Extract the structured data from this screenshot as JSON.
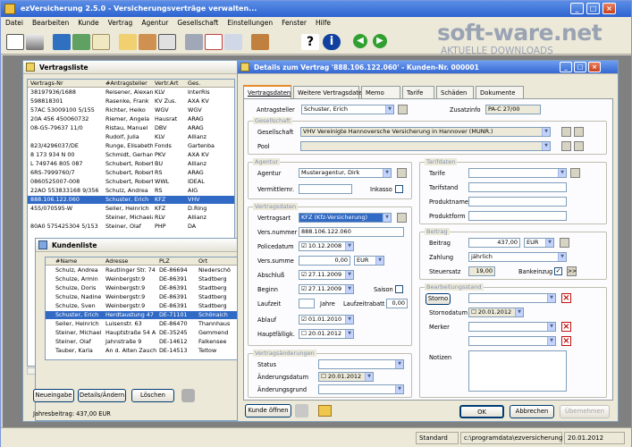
{
  "app": {
    "title": "ezVersicherung 2.5.0  -  Versicherungsverträge verwalten...",
    "watermark_top": "soft-ware.net",
    "watermark_bottom": "AKTUELLE DOWNLOADS"
  },
  "menu": [
    "Datei",
    "Bearbeiten",
    "Kunde",
    "Vertrag",
    "Agentur",
    "Gesellschaft",
    "Einstellungen",
    "Fenster",
    "Hilfe"
  ],
  "vertragsliste": {
    "title": "Vertragsliste",
    "headers": [
      "Vertrags-Nr",
      "#Antragsteller",
      "Vertr.Art",
      "Ges."
    ],
    "rows": [
      [
        "38197936/1688",
        "Reisener, Alexander",
        "KLV",
        "InterRis"
      ],
      [
        "598818301",
        "Rasenke, Frank",
        "KV Zus.",
        "AXA KV"
      ],
      [
        "57AC 53009100 5/155",
        "Richter, Heiko",
        "WGV",
        "WGV"
      ],
      [
        "20A 456 450060732",
        "Riemer, Angela",
        "Hausrat",
        "ARAG"
      ],
      [
        "08-G5-79637 11/0",
        "Ristau, Manuel",
        "DBV",
        "ARAG"
      ],
      [
        "",
        "Rudolf, Julia",
        "KLV",
        "Allianz"
      ],
      [
        "823/4296037/DE",
        "Runge, Elisabeth",
        "Fonds",
        "Gartenba"
      ],
      [
        "8 173 934 N 00",
        "Schmidt, Gerhardt",
        "PKV",
        "AXA KV"
      ],
      [
        "L 749746 805 087",
        "Schubert, Robert",
        "BU",
        "Allianz"
      ],
      [
        "6RS-7999760/7",
        "Schubert, Robert",
        "RS",
        "ARAG"
      ],
      [
        "0860525007-008",
        "Schubert, Robert",
        "WWL",
        "IDEAL"
      ],
      [
        "22AO 553833168 9/356",
        "Schulz, Andrea",
        "RS",
        "AIG"
      ],
      [
        "888.106.122.060",
        "Schuster, Erich",
        "KFZ",
        "VHV"
      ],
      [
        "455/070595-W",
        "Seiler, Heinrich",
        "KFZ",
        "D.Ring"
      ],
      [
        "",
        "Steiner, Michaela",
        "RLV",
        "Allianz"
      ],
      [
        "80A0 575425304 5/153",
        "Steiner, Olaf",
        "PHP",
        "DA"
      ]
    ],
    "selected_row": 12
  },
  "kundenliste": {
    "title": "Kundenliste",
    "headers": [
      "#Name",
      "Adresse",
      "PLZ",
      "Ort"
    ],
    "rows": [
      [
        "Schulz, Andrea",
        "Rautlinger Str. 74",
        "DE-86694",
        "Niederschö"
      ],
      [
        "Schulze, Armin",
        "Weinbergstr.9",
        "DE-86391",
        "Stadtberg"
      ],
      [
        "Schulze, Doris",
        "Weinbergstr.9",
        "DE-86391",
        "Stadtberg"
      ],
      [
        "Schulze, Nadine",
        "Weinbergstr.9",
        "DE-86391",
        "Stadtberg"
      ],
      [
        "Schulze, Sven",
        "Weinbergstr.9",
        "DE-86391",
        "Stadtberg"
      ],
      [
        "Schuster, Erich",
        "Herdtaustung 47",
        "DE-71101",
        "Schönaich"
      ],
      [
        "Seiler, Heinrich",
        "Luisenstr. 63",
        "DE-86470",
        "Thannhaus"
      ],
      [
        "Steiner, Michaela",
        "Hauptstraße 54 A",
        "DE-35245",
        "Gemmend"
      ],
      [
        "Steiner, Olaf",
        "Jahnstraße 9",
        "DE-14612",
        "Falkensee"
      ],
      [
        "Tauber, Karla",
        "An d. Alten Zauche 2",
        "DE-14513",
        "Teltow"
      ]
    ],
    "selected_row": 5,
    "buttons": {
      "new": "Neueingabe",
      "edit": "Details/Ändern",
      "delete": "Löschen"
    },
    "footer": "Jahresbeitrag: 437,00 EUR"
  },
  "details": {
    "title": "Details zum Vertrag '888.106.122.060' - Kunden-Nr. 000001",
    "tabs": [
      "Vertragsdaten",
      "Weitere Vertragsdaten",
      "Memo",
      "Tarife",
      "Schäden",
      "Dokumente"
    ],
    "antragsteller_label": "Antragsteller",
    "antragsteller": "Schuster, Erich",
    "zusatzinfo_label": "Zusatzinfo",
    "zusatzinfo": "PA-C 27/00",
    "gesellschaft_group": "Gesellschaft",
    "gesellschaft_label": "Gesellschaft",
    "gesellschaft": "VHV Vereinigte Hannoversche Versicherung in Hannover (MUNR.)",
    "pool_label": "Pool",
    "agentur_group": "Agentur",
    "agentur_label": "Agentur",
    "agentur": "Musteragentur, Dirk",
    "vermittlernr_label": "Vermittlernr.",
    "inkasso_label": "Inkasso",
    "vertrag_group": "Vertragsdaten",
    "vertragsart_label": "Vertragsart",
    "vertragsart": "KFZ (Kfz-Versicherung)",
    "versnummer_label": "Vers.nummer",
    "versnummer": "888.106.122.060",
    "policedatum_label": "Policedatum",
    "policedatum": "10.12.2008",
    "verssumme_label": "Vers.summe",
    "verssumme": "0,00",
    "verssumme_currency": "EUR",
    "abschluss_label": "Abschluß",
    "abschluss": "27.11.2009",
    "beginn_label": "Beginn",
    "beginn": "27.11.2009",
    "saison_label": "Saison",
    "laufzeit_label": "Laufzeit",
    "jahre_label": "Jahre",
    "laufzeitrabatt_label": "Laufzeitrabatt",
    "laufzeitrabatt": "0,00",
    "ablauf_label": "Ablauf",
    "ablauf": "01.01.2010",
    "hauptfaellig_label": "Hauptfälligk.",
    "hauptfaellig": "20.01.2012",
    "aend_group": "Vertragsänderungen",
    "status_label": "Status",
    "aenddatum_label": "Änderungsdatum",
    "aenddatum": "20.01.2012",
    "aendgrund_label": "Änderungsgrund",
    "tarif_group": "Tarifdaten",
    "tarife_label": "Tarife",
    "tarifstand_label": "Tarifstand",
    "produktname_label": "Produktname",
    "produktform_label": "Produktform",
    "beitrag_group": "Beitrag",
    "beitrag_label": "Beitrag",
    "beitrag": "437,00",
    "beitrag_currency": "EUR",
    "zahlung_label": "Zahlung",
    "zahlung": "jährlich",
    "steuersatz_label": "Steuersatz",
    "steuersatz": "19,00",
    "bankeinzug_label": "Bankeinzug",
    "bearb_group": "Bearbeitungsstand",
    "storno_button": "Storno",
    "stornodatum_label": "Stornodatum",
    "stornodatum": "20.01.2012",
    "merker_label": "Merker",
    "notizen_label": "Notizen",
    "kunde_oeffnen": "Kunde öffnen",
    "ok": "OK",
    "abbrechen": "Abbrechen",
    "uebernehmen": "Übernehmen"
  },
  "status": {
    "mode": "Standard",
    "path": "c:\\programdata\\ezversicherung",
    "date": "20.01.2012"
  },
  "colors": {
    "title_gradient_top": "#5a8ee6",
    "selection": "#316ac5",
    "window_bg": "#ece9d8",
    "delete_red": "#c01010"
  },
  "icons": [
    "app-icon",
    "new-document-icon",
    "filter-icon",
    "book-icon",
    "people-icon",
    "document-icon",
    "calculator-icon",
    "calendar-icon",
    "question-icon",
    "info-icon",
    "arrow-left-icon",
    "arrow-right-icon"
  ]
}
